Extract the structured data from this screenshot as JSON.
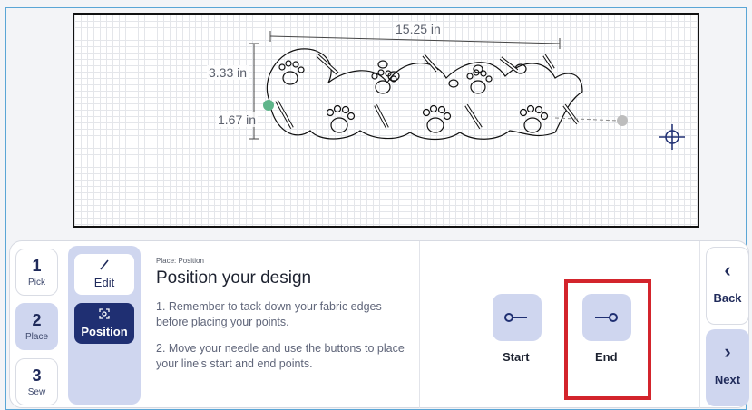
{
  "canvas": {
    "dimensions": {
      "width": "15.25 in",
      "height": "3.33 in",
      "half_height": "1.67 in"
    }
  },
  "steps": [
    {
      "num": "1",
      "label": "Pick"
    },
    {
      "num": "2",
      "label": "Place"
    },
    {
      "num": "3",
      "label": "Sew"
    }
  ],
  "modes": {
    "edit_label": "Edit",
    "position_label": "Position"
  },
  "info": {
    "breadcrumb": "Place: Position",
    "title": "Position your design",
    "step1": "1. Remember to tack down your fabric edges before placing your points.",
    "step2": "2. Move your needle and use the buttons to place your line's start and end points."
  },
  "points": {
    "start_label": "Start",
    "end_label": "End"
  },
  "nav": {
    "back_label": "Back",
    "next_label": "Next"
  },
  "colors": {
    "accent": "#1f2f72",
    "button_bg": "#cfd6ef",
    "highlight": "#d3242c",
    "start_point": "#5fb58a"
  }
}
